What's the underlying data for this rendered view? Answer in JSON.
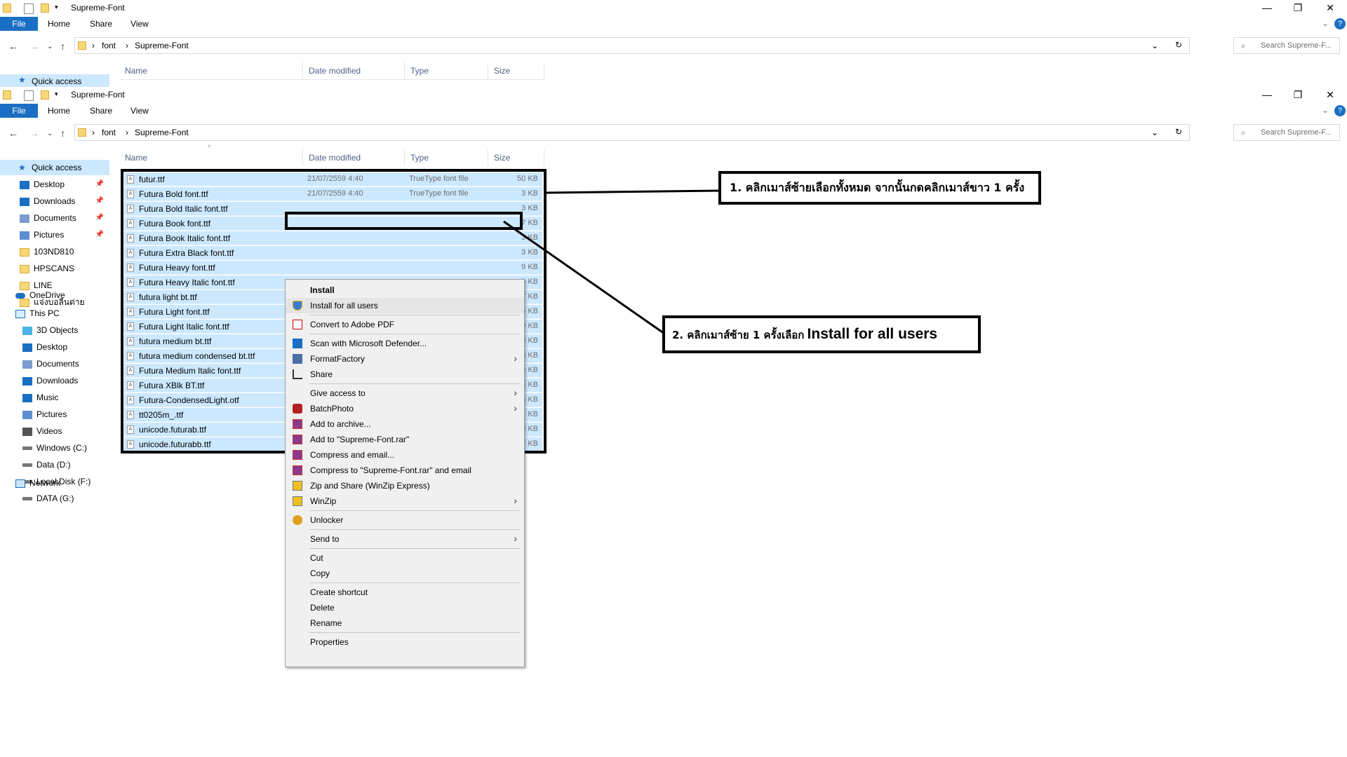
{
  "window": {
    "title": "Supreme-Font",
    "ribbon_tabs": [
      "File",
      "Home",
      "Share",
      "View"
    ],
    "breadcrumb": [
      "font",
      "Supreme-Font"
    ],
    "search_placeholder": "Search Supreme-F...",
    "minimize": "—",
    "maximize": "❐",
    "close": "✕"
  },
  "columns": {
    "name": "Name",
    "date": "Date modified",
    "type": "Type",
    "size": "Size"
  },
  "sidebar": {
    "quick_access": "Quick access",
    "items": [
      {
        "label": "Desktop",
        "icon": "desktop-icon",
        "pinned": true
      },
      {
        "label": "Downloads",
        "icon": "downloads-icon",
        "pinned": true
      },
      {
        "label": "Documents",
        "icon": "documents-icon",
        "pinned": true
      },
      {
        "label": "Pictures",
        "icon": "pictures-icon",
        "pinned": true
      },
      {
        "label": "103ND810",
        "icon": "folder-icon",
        "pinned": false
      },
      {
        "label": "HPSCANS",
        "icon": "folder-icon",
        "pinned": false
      },
      {
        "label": "LINE",
        "icon": "folder-icon",
        "pinned": false
      },
      {
        "label": "แจ่งบอลีนด่าย",
        "icon": "folder-icon",
        "pinned": false
      }
    ],
    "onedrive": "OneDrive",
    "this_pc": "This PC",
    "pc_items": [
      {
        "label": "3D Objects",
        "icon": "3d-objects-icon"
      },
      {
        "label": "Desktop",
        "icon": "desktop-icon"
      },
      {
        "label": "Documents",
        "icon": "documents-icon"
      },
      {
        "label": "Downloads",
        "icon": "downloads-icon"
      },
      {
        "label": "Music",
        "icon": "music-icon"
      },
      {
        "label": "Pictures",
        "icon": "pictures-icon"
      },
      {
        "label": "Videos",
        "icon": "videos-icon"
      },
      {
        "label": "Windows (C:)",
        "icon": "drive-icon"
      },
      {
        "label": "Data (D:)",
        "icon": "drive-icon"
      },
      {
        "label": "Local Disk (F:)",
        "icon": "drive-icon"
      },
      {
        "label": "DATA (G:)",
        "icon": "drive-icon"
      }
    ],
    "network": "Network"
  },
  "files": [
    {
      "name": "futur.ttf",
      "date": "21/07/2559 4:40",
      "type": "TrueType font file",
      "size": "50 KB"
    },
    {
      "name": "Futura Bold font.ttf",
      "date": "21/07/2559 4:40",
      "type": "TrueType font file",
      "size": "3 KB"
    },
    {
      "name": "Futura Bold Italic font.ttf",
      "date": "",
      "type": "",
      "size": "3 KB"
    },
    {
      "name": "Futura Book font.ttf",
      "date": "",
      "type": "",
      "size": "7 KB"
    },
    {
      "name": "Futura Book Italic font.ttf",
      "date": "",
      "type": "",
      "size": "3 KB"
    },
    {
      "name": "Futura Extra Black font.ttf",
      "date": "",
      "type": "",
      "size": "3 KB"
    },
    {
      "name": "Futura Heavy font.ttf",
      "date": "",
      "type": "",
      "size": "9 KB"
    },
    {
      "name": "Futura Heavy Italic font.ttf",
      "date": "",
      "type": "",
      "size": "9 KB"
    },
    {
      "name": "futura light bt.ttf",
      "date": "",
      "type": "",
      "size": "7 KB"
    },
    {
      "name": "Futura Light font.ttf",
      "date": "",
      "type": "",
      "size": "5 KB"
    },
    {
      "name": "Futura Light Italic font.ttf",
      "date": "",
      "type": "",
      "size": "9 KB"
    },
    {
      "name": "futura medium bt.ttf",
      "date": "",
      "type": "",
      "size": "3 KB"
    },
    {
      "name": "futura medium condensed bt.ttf",
      "date": "",
      "type": "",
      "size": "3 KB"
    },
    {
      "name": "Futura Medium Italic font.ttf",
      "date": "",
      "type": "",
      "size": "9 KB"
    },
    {
      "name": "Futura XBlk BT.ttf",
      "date": "",
      "type": "",
      "size": "3 KB"
    },
    {
      "name": "Futura-CondensedLight.otf",
      "date": "",
      "type": "",
      "size": "3 KB"
    },
    {
      "name": "tt0205m_.ttf",
      "date": "",
      "type": "",
      "size": "1 KB"
    },
    {
      "name": "unicode.futurab.ttf",
      "date": "",
      "type": "",
      "size": "3 KB"
    },
    {
      "name": "unicode.futurabb.ttf",
      "date": "",
      "type": "",
      "size": "7 KB"
    }
  ],
  "context_menu": [
    {
      "label": "Install",
      "bold": true,
      "icon": "",
      "submenu": false
    },
    {
      "label": "Install for all users",
      "bold": false,
      "icon": "shield-icon",
      "submenu": false
    },
    {
      "sep": true
    },
    {
      "label": "Convert to Adobe PDF",
      "bold": false,
      "icon": "adobe-pdf-icon",
      "submenu": false
    },
    {
      "sep": true
    },
    {
      "label": "Scan with Microsoft Defender...",
      "bold": false,
      "icon": "defender-icon",
      "submenu": false
    },
    {
      "label": "FormatFactory",
      "bold": false,
      "icon": "formatfactory-icon",
      "submenu": true
    },
    {
      "label": "Share",
      "bold": false,
      "icon": "share-icon",
      "submenu": false
    },
    {
      "sep": true
    },
    {
      "label": "Give access to",
      "bold": false,
      "icon": "",
      "submenu": true
    },
    {
      "label": "BatchPhoto",
      "bold": false,
      "icon": "batchphoto-icon",
      "submenu": true
    },
    {
      "label": "Add to archive...",
      "bold": false,
      "icon": "winrar-icon",
      "submenu": false
    },
    {
      "label": "Add to \"Supreme-Font.rar\"",
      "bold": false,
      "icon": "winrar-icon",
      "submenu": false
    },
    {
      "label": "Compress and email...",
      "bold": false,
      "icon": "winrar-icon",
      "submenu": false
    },
    {
      "label": "Compress to \"Supreme-Font.rar\" and email",
      "bold": false,
      "icon": "winrar-icon",
      "submenu": false
    },
    {
      "label": "Zip and Share (WinZip Express)",
      "bold": false,
      "icon": "winzip-icon",
      "submenu": false
    },
    {
      "label": "WinZip",
      "bold": false,
      "icon": "winzip-icon",
      "submenu": true
    },
    {
      "sep": true
    },
    {
      "label": "Unlocker",
      "bold": false,
      "icon": "unlocker-icon",
      "submenu": false
    },
    {
      "sep": true
    },
    {
      "label": "Send to",
      "bold": false,
      "icon": "",
      "submenu": true
    },
    {
      "sep": true
    },
    {
      "label": "Cut",
      "bold": false,
      "icon": "",
      "submenu": false
    },
    {
      "label": "Copy",
      "bold": false,
      "icon": "",
      "submenu": false
    },
    {
      "sep": true
    },
    {
      "label": "Create shortcut",
      "bold": false,
      "icon": "",
      "submenu": false
    },
    {
      "label": "Delete",
      "bold": false,
      "icon": "",
      "submenu": false
    },
    {
      "label": "Rename",
      "bold": false,
      "icon": "",
      "submenu": false
    },
    {
      "sep": true
    },
    {
      "label": "Properties",
      "bold": false,
      "icon": "",
      "submenu": false
    }
  ],
  "callouts": {
    "step1": "1. คลิกเมาส์ซ้ายเลือกทั้งหมด จากนั้นกดคลิกเมาส์ขาว 1 ครั้ง",
    "step2_prefix": "2. คลิกเมาส์ซ้าย 1 ครั้งเลือก",
    "step2_bold": "Install for all users"
  },
  "colors": {
    "selection": "#cce8ff",
    "file_tab": "#1a6fc4",
    "accent": "#1a6fc4",
    "callout_border": "#000000"
  }
}
